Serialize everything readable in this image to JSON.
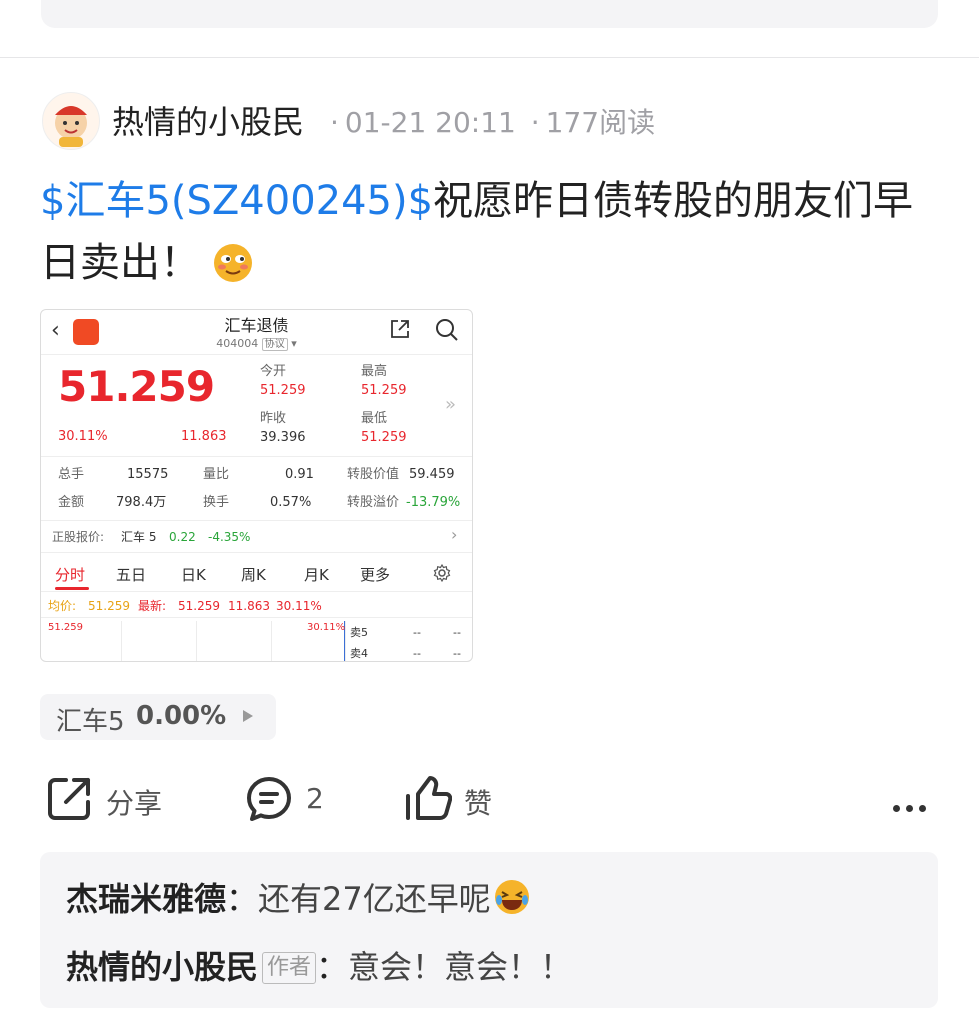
{
  "post": {
    "author": "热情的小股民",
    "date": "01-21 20:11",
    "reads": "177阅读",
    "stock_tag": "$汇车5(SZ400245)$",
    "text": "祝愿昨日债转股的朋友们早日卖出！"
  },
  "screenshot": {
    "title": "汇车退债",
    "code": "404004",
    "code_tag": "协议",
    "price": "51.259",
    "change_pct": "30.11%",
    "change": "11.863",
    "open_label": "今开",
    "open": "51.259",
    "high_label": "最高",
    "high": "51.259",
    "prev_close_label": "昨收",
    "prev_close": "39.396",
    "low_label": "最低",
    "low": "51.259",
    "volume_label": "总手",
    "volume": "15575",
    "vol_ratio_label": "量比",
    "vol_ratio": "0.91",
    "conv_value_label": "转股价值",
    "conv_value": "59.459",
    "amount_label": "金额",
    "amount": "798.4万",
    "turnover_label": "换手",
    "turnover": "0.57%",
    "conv_premium_label": "转股溢价",
    "conv_premium": "-13.79%",
    "underlying_label": "正股报价:",
    "underlying_name": "汇车 5",
    "underlying_price": "0.22",
    "underlying_pct": "-4.35%",
    "tabs": [
      "分时",
      "五日",
      "日K",
      "周K",
      "月K",
      "更多"
    ],
    "avg_label": "均价:",
    "avg": "51.259",
    "latest_label": "最新:",
    "latest": "51.259",
    "latest_change": "11.863",
    "latest_pct": "30.11%",
    "chart_top_left": "51.259",
    "chart_top_right": "30.11%",
    "ask5_label": "卖5",
    "ask4_label": "卖4",
    "ask5_price": "--",
    "ask5_vol": "--",
    "ask4_price": "--",
    "ask4_vol": "--"
  },
  "chip": {
    "name": "汇车5",
    "value": "0.00%"
  },
  "actions": {
    "share": "分享",
    "comment_count": "2",
    "like": "赞"
  },
  "comments": [
    {
      "author": "杰瑞米雅德",
      "separator": "：",
      "text": "还有27亿还早呢"
    },
    {
      "author": "热情的小股民",
      "badge": "作者",
      "separator": "：",
      "text": "意会！意会！！"
    }
  ],
  "colors": {
    "link": "#1e7ce8",
    "up_red": "#e8262d",
    "down_green": "#2aa53a"
  }
}
